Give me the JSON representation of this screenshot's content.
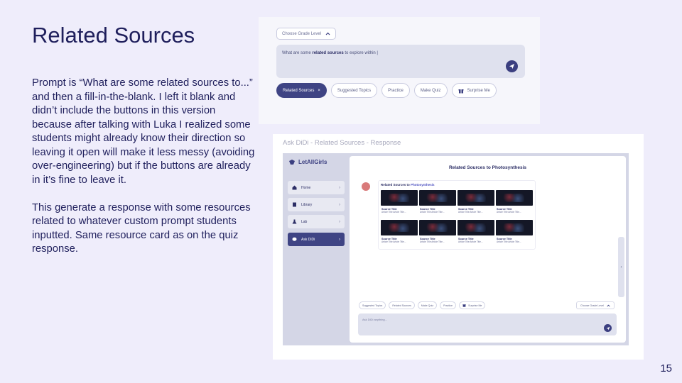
{
  "slide": {
    "title": "Related Sources",
    "paragraphs": [
      "Prompt is “What are some related sources to...” and then a fill-in-the-blank. I left it blank and didn’t include the buttons in this version because after talking with Luka I realized some students might already know their direction so leaving it open will make it less messy (avoiding over-engineering) but if the buttons are already in it’s fine to leave it.",
      "This generate a response with some resources related to whatever custom prompt students inputted. Same resource card as on the quiz response."
    ],
    "page_number": "15"
  },
  "prompt_mockup": {
    "grade_select": "Choose Grade Level",
    "prompt_prefix": "What are some ",
    "prompt_bold": "related sources",
    "prompt_suffix": " to explore within |",
    "chips": [
      {
        "label": "Related Sources",
        "active": true,
        "close": "×"
      },
      {
        "label": "Suggested Topics"
      },
      {
        "label": "Practice"
      },
      {
        "label": "Make Quiz"
      },
      {
        "label": "Surprise Me",
        "icon": "gift-icon"
      }
    ]
  },
  "caption": "Ask DiDi - Related Sources - Response",
  "app": {
    "logo": "LetAllGirls",
    "sidebar": [
      {
        "label": "Home",
        "icon": "home-icon"
      },
      {
        "label": "Library",
        "icon": "book-icon"
      },
      {
        "label": "Lab",
        "icon": "flask-icon"
      },
      {
        "label": "Ask DiDi",
        "icon": "chat-icon",
        "active": true
      }
    ],
    "response_title": "Related Sources to Photosynthesis",
    "sources_heading_prefix": "Related Sources to ",
    "sources_heading_topic": "Photosynthesis",
    "sources": [
      {
        "title": "Source Title",
        "subtitle": "Article Title Article Title..."
      },
      {
        "title": "Source Title",
        "subtitle": "Article Title Article Title..."
      },
      {
        "title": "Source Title",
        "subtitle": "Article Title Article Title..."
      },
      {
        "title": "Source Title",
        "subtitle": "Article Title Article Title..."
      },
      {
        "title": "Source Title",
        "subtitle": "Article Title Article Title..."
      },
      {
        "title": "Source Title",
        "subtitle": "Article Title Article Title..."
      },
      {
        "title": "Source Title",
        "subtitle": "Article Title Article Title..."
      },
      {
        "title": "Source Title",
        "subtitle": "Article Title Article Title..."
      }
    ],
    "bottom_chips": [
      "Suggested Topics",
      "Related Sources",
      "Make Quiz",
      "Practice",
      "Surprise Me"
    ],
    "bottom_grade": "Choose Grade Level",
    "input_placeholder": "Ask DiDi anything..."
  },
  "colors": {
    "background": "#efedfb",
    "ink": "#1f1f5c",
    "accent": "#3f4484"
  }
}
